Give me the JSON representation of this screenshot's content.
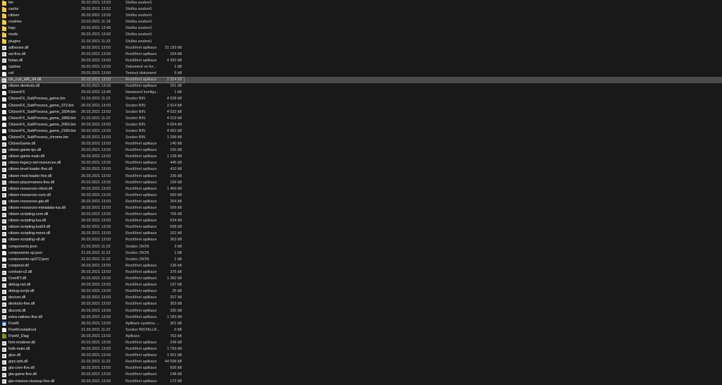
{
  "files": [
    {
      "name": "bin",
      "date": "26.03.2021 13:03",
      "type": "Složka souborů",
      "size": "",
      "icon": "folder-icon"
    },
    {
      "name": "cache",
      "date": "29.03.2021 13:52",
      "type": "Složka souborů",
      "size": "",
      "icon": "folder-icon"
    },
    {
      "name": "citizen",
      "date": "26.03.2021 13:03",
      "type": "Složka souborů",
      "size": "",
      "icon": "folder-icon"
    },
    {
      "name": "crashes",
      "date": "23.03.2021 11:18",
      "type": "Složka souborů",
      "size": "",
      "icon": "folder-icon"
    },
    {
      "name": "logs",
      "date": "29.03.2021 13:49",
      "type": "Složka souborů",
      "size": "",
      "icon": "folder-icon"
    },
    {
      "name": "mods",
      "date": "26.03.2021 13:03",
      "type": "Složka souborů",
      "size": "",
      "icon": "folder-icon"
    },
    {
      "name": "plugins",
      "date": "21.03.2021 11:23",
      "type": "Složka souborů",
      "size": "",
      "icon": "folder-icon"
    },
    {
      "name": "adhesive.dll",
      "date": "26.03.2021 13:03",
      "type": "Rozšíření aplikace",
      "size": "31 193 kB",
      "icon": "dll-icon"
    },
    {
      "name": "asi-five.dll",
      "date": "26.03.2021 13:03",
      "type": "Rozšíření aplikace",
      "size": "164 kB",
      "icon": "dll-icon"
    },
    {
      "name": "botan.dll",
      "date": "26.03.2021 13:03",
      "type": "Rozšíření aplikace",
      "size": "4 392 kB",
      "icon": "dll-icon"
    },
    {
      "name": "caches",
      "date": "26.03.2021 13:03",
      "type": "Dokument ve for...",
      "size": "1 kB",
      "icon": "file-icon"
    },
    {
      "name": "cef",
      "date": "29.03.2021 13:50",
      "type": "Textový dokument",
      "size": "5 kB",
      "icon": "file-icon"
    },
    {
      "name": "cfx_curl_x86_64.dll",
      "date": "26.03.2021 13:03",
      "type": "Rozšíření aplikace",
      "size": "2 324 kB",
      "icon": "dll-icon",
      "selected": true
    },
    {
      "name": "citizen-devtools.dll",
      "date": "26.03.2021 13:03",
      "type": "Rozšíření aplikace",
      "size": "201 kB",
      "icon": "dll-icon"
    },
    {
      "name": "CitizenFX",
      "date": "29.03.2021 13:49",
      "type": "Nastavení konfigu...",
      "size": "1 kB",
      "icon": "file-icon"
    },
    {
      "name": "CitizenFX_SubProcess_game.bin",
      "date": "21.03.2021 11:22",
      "type": "Soubor BIN",
      "size": "4 028 kB",
      "icon": "file-icon"
    },
    {
      "name": "CitizenFX_SubProcess_game_372.bin",
      "date": "26.03.2021 13:03",
      "type": "Soubor BIN",
      "size": "3 914 kB",
      "icon": "file-icon"
    },
    {
      "name": "CitizenFX_SubProcess_game_1604.bin",
      "date": "26.03.2021 13:03",
      "type": "Soubor BIN",
      "size": "4 032 kB",
      "icon": "file-icon"
    },
    {
      "name": "CitizenFX_SubProcess_game_1868.bin",
      "date": "21.03.2021 11:22",
      "type": "Soubor BIN",
      "size": "4 019 kB",
      "icon": "file-icon"
    },
    {
      "name": "CitizenFX_SubProcess_game_2060.bin",
      "date": "26.03.2021 13:03",
      "type": "Soubor BIN",
      "size": "4 054 kB",
      "icon": "file-icon"
    },
    {
      "name": "CitizenFX_SubProcess_game_2189.bin",
      "date": "26.03.2021 13:03",
      "type": "Soubor BIN",
      "size": "4 062 kB",
      "icon": "file-icon"
    },
    {
      "name": "CitizenFX_SubProcess_chrome.bin",
      "date": "26.03.2021 13:03",
      "type": "Soubor BIN",
      "size": "1 258 kB",
      "icon": "file-icon"
    },
    {
      "name": "CitizenGame.dll",
      "date": "26.03.2021 13:03",
      "type": "Rozšíření aplikace",
      "size": "140 kB",
      "icon": "dll-icon"
    },
    {
      "name": "citizen-game-ipc.dll",
      "date": "26.03.2021 13:03",
      "type": "Rozšíření aplikace",
      "size": "150 kB",
      "icon": "dll-icon"
    },
    {
      "name": "citizen-game-main.dll",
      "date": "26.03.2021 13:03",
      "type": "Rozšíření aplikace",
      "size": "1 128 kB",
      "icon": "dll-icon"
    },
    {
      "name": "citizen-legacy-net-resources.dll",
      "date": "26.03.2021 13:03",
      "type": "Rozšíření aplikace",
      "size": "445 kB",
      "icon": "dll-icon"
    },
    {
      "name": "citizen-level-loader-five.dll",
      "date": "26.03.2021 13:03",
      "type": "Rozšíření aplikace",
      "size": "410 kB",
      "icon": "dll-icon"
    },
    {
      "name": "citizen-mod-loader-five.dll",
      "date": "26.03.2021 13:03",
      "type": "Rozšíření aplikace",
      "size": "236 kB",
      "icon": "dll-icon"
    },
    {
      "name": "citizen-playernames-five.dll",
      "date": "26.03.2021 13:03",
      "type": "Rozšíření aplikace",
      "size": "199 kB",
      "icon": "dll-icon"
    },
    {
      "name": "citizen-resources-client.dll",
      "date": "26.03.2021 13:03",
      "type": "Rozšíření aplikace",
      "size": "1 469 kB",
      "icon": "dll-icon"
    },
    {
      "name": "citizen-resources-core.dll",
      "date": "26.03.2021 13:03",
      "type": "Rozšíření aplikace",
      "size": "560 kB",
      "icon": "dll-icon"
    },
    {
      "name": "citizen-resources-gta.dll",
      "date": "26.03.2021 13:03",
      "type": "Rozšíření aplikace",
      "size": "264 kB",
      "icon": "dll-icon"
    },
    {
      "name": "citizen-resources-metadata-lua.dll",
      "date": "26.03.2021 13:03",
      "type": "Rozšíření aplikace",
      "size": "599 kB",
      "icon": "dll-icon"
    },
    {
      "name": "citizen-scripting-core.dll",
      "date": "26.03.2021 13:03",
      "type": "Rozšíření aplikace",
      "size": "706 kB",
      "icon": "dll-icon"
    },
    {
      "name": "citizen-scripting-lua.dll",
      "date": "26.03.2021 13:03",
      "type": "Rozšíření aplikace",
      "size": "634 kB",
      "icon": "dll-icon"
    },
    {
      "name": "citizen-scripting-lua54.dll",
      "date": "26.03.2021 13:03",
      "type": "Rozšíření aplikace",
      "size": "698 kB",
      "icon": "dll-icon"
    },
    {
      "name": "citizen-scripting-mono.dll",
      "date": "26.03.2021 13:03",
      "type": "Rozšíření aplikace",
      "size": "162 kB",
      "icon": "dll-icon"
    },
    {
      "name": "citizen-scripting-v8.dll",
      "date": "26.03.2021 13:03",
      "type": "Rozšíření aplikace",
      "size": "363 kB",
      "icon": "dll-icon"
    },
    {
      "name": "components.json",
      "date": "21.03.2021 11:22",
      "type": "Soubor JSON",
      "size": "2 kB",
      "icon": "file-icon"
    },
    {
      "name": "components-sp.json",
      "date": "21.03.2021 11:22",
      "type": "Soubor JSON",
      "size": "1 kB",
      "icon": "file-icon"
    },
    {
      "name": "components-sp372.json",
      "date": "21.03.2021 11:22",
      "type": "Soubor JSON",
      "size": "1 kB",
      "icon": "file-icon"
    },
    {
      "name": "comptest.dll",
      "date": "26.03.2021 13:03",
      "type": "Rozšíření aplikace",
      "size": "136 kB",
      "icon": "dll-icon"
    },
    {
      "name": "conhost-v2.dll",
      "date": "26.03.2021 13:03",
      "type": "Rozšíření aplikace",
      "size": "375 kB",
      "icon": "dll-icon"
    },
    {
      "name": "CoreRT.dll",
      "date": "26.03.2021 13:03",
      "type": "Rozšíření aplikace",
      "size": "1 382 kB",
      "icon": "dll-icon"
    },
    {
      "name": "debug-net.dll",
      "date": "26.03.2021 13:03",
      "type": "Rozšíření aplikace",
      "size": "197 kB",
      "icon": "dll-icon"
    },
    {
      "name": "debug-script.dll",
      "date": "26.03.2021 13:03",
      "type": "Rozšíření aplikace",
      "size": "25 kB",
      "icon": "dll-icon"
    },
    {
      "name": "devcon.dll",
      "date": "26.03.2021 13:03",
      "type": "Rozšíření aplikace",
      "size": "207 kB",
      "icon": "dll-icon"
    },
    {
      "name": "devtools-five.dll",
      "date": "26.03.2021 13:03",
      "type": "Rozšíření aplikace",
      "size": "303 kB",
      "icon": "dll-icon"
    },
    {
      "name": "discord.dll",
      "date": "26.03.2021 13:03",
      "type": "Rozšíření aplikace",
      "size": "330 kB",
      "icon": "dll-icon"
    },
    {
      "name": "extra-natives-five.dll",
      "date": "26.03.2021 13:03",
      "type": "Rozšíření aplikace",
      "size": "1 183 kB",
      "icon": "dll-icon"
    },
    {
      "name": "FiveM",
      "date": "26.03.2021 13:03",
      "type": "Aplikace systému ...",
      "size": "301 kB",
      "icon": "exe-icon"
    },
    {
      "name": "FiveM.installroot",
      "date": "21.03.2021 11:22",
      "type": "Soubor INSTALLR...",
      "size": "0 kB",
      "icon": "file-icon"
    },
    {
      "name": "FiveM_Diag",
      "date": "26.03.2021 13:03",
      "type": "Aplikace",
      "size": "763 kB",
      "icon": "app-folder-icon"
    },
    {
      "name": "font-renderer.dll",
      "date": "26.03.2021 13:03",
      "type": "Rozšíření aplikace",
      "size": "249 kB",
      "icon": "dll-icon"
    },
    {
      "name": "fxdk-main.dll",
      "date": "26.03.2021 13:03",
      "type": "Rozšíření aplikace",
      "size": "1 793 kB",
      "icon": "dll-icon"
    },
    {
      "name": "glue.dll",
      "date": "26.03.2021 13:03",
      "type": "Rozšíření aplikace",
      "size": "1 501 kB",
      "icon": "dll-icon"
    },
    {
      "name": "grpc-ipfs.dll",
      "date": "21.03.2021 11:22",
      "type": "Rozšíření aplikace",
      "size": "44 598 kB",
      "icon": "dll-icon"
    },
    {
      "name": "gta-core-five.dll",
      "date": "26.03.2021 13:03",
      "type": "Rozšíření aplikace",
      "size": "936 kB",
      "icon": "dll-icon"
    },
    {
      "name": "gta-game-five.dll",
      "date": "26.03.2021 13:03",
      "type": "Rozšíření aplikace",
      "size": "148 kB",
      "icon": "dll-icon"
    },
    {
      "name": "gta-mission-cleanup-five.dll",
      "date": "26.03.2021 13:03",
      "type": "Rozšíření aplikace",
      "size": "172 kB",
      "icon": "dll-icon"
    }
  ]
}
